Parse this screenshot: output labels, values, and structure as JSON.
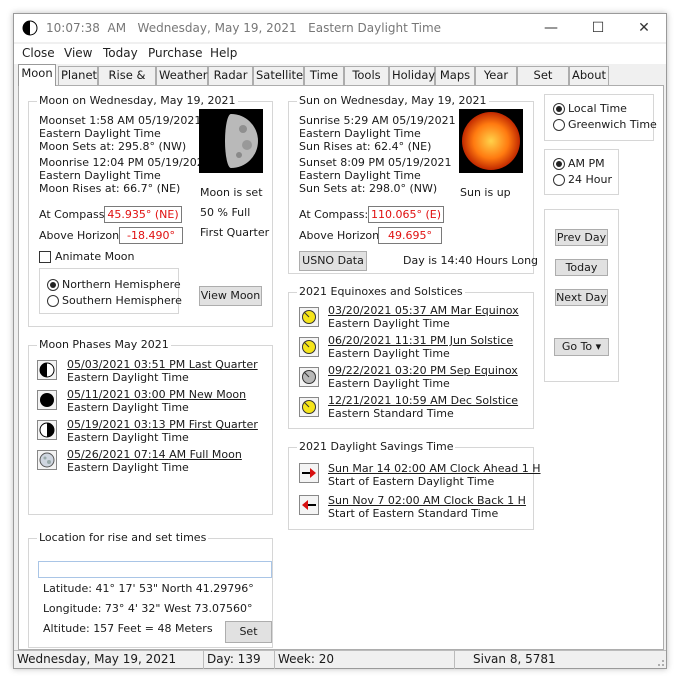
{
  "window": {
    "title": "10:07:38  AM   Wednesday, May 19, 2021   Eastern Daylight Time",
    "minimize": "—",
    "maximize": "☐",
    "close": "✕"
  },
  "menu": [
    "Close",
    "View",
    "Today",
    "Purchase",
    "Help"
  ],
  "tabs": [
    "Moon",
    "Planet",
    "Rise & Set",
    "Weather",
    "Radar",
    "Satellite",
    "Time",
    "Tools",
    "Holiday",
    "Maps",
    "Year",
    "Set",
    "About"
  ],
  "moon": {
    "header": "Moon on Wednesday, May 19, 2021",
    "moonset": "Moonset  1:58 AM  05/19/2021",
    "moonset_tz": "Eastern Daylight Time",
    "moon_sets_at": "Moon Sets at:  295.8° (NW)",
    "moonrise": "Moonrise 12:04 PM  05/19/2021",
    "moonrise_tz": "Eastern Daylight Time",
    "moon_rises_at": "Moon Rises at:  66.7° (NE)",
    "status": "Moon is set",
    "percent_full": "50 % Full",
    "phase_name": "First Quarter",
    "at_compass_label": "At Compass:",
    "at_compass_value": "45.935° (NE)",
    "above_horizon_label": "Above Horizon:",
    "above_horizon_value": "-18.490°",
    "animate_label": "Animate Moon",
    "hemisphere_north": "Northern Hemisphere",
    "hemisphere_south": "Southern Hemisphere",
    "view_moon_btn": "View Moon"
  },
  "sun": {
    "header": "Sun on Wednesday, May 19, 2021",
    "sunrise": "Sunrise 5:29 AM  05/19/2021",
    "sunrise_tz": "Eastern Daylight Time",
    "sun_rises_at": "Sun Rises at:  62.4° (NE)",
    "sunset": "Sunset  8:09 PM  05/19/2021",
    "sunset_tz": "Eastern Daylight Time",
    "sun_sets_at": "Sun Sets at:  298.0° (NW)",
    "status": "Sun is up",
    "at_compass_label": "At Compass:",
    "at_compass_value": "110.065° (E)",
    "above_horizon_label": "Above Horizon:",
    "above_horizon_value": "49.695°",
    "usno_btn": "USNO Data",
    "day_length": "Day is 14:40 Hours Long"
  },
  "options": {
    "local_time": "Local Time",
    "greenwich_time": "Greenwich Time",
    "am_pm": "AM PM",
    "h24": "24 Hour",
    "prev_day": "Prev Day",
    "today": "Today",
    "next_day": "Next Day",
    "go_to": "Go To ▾"
  },
  "phases": {
    "header": "Moon Phases  May 2021",
    "items": [
      {
        "line": "05/03/2021   03:51  PM   Last Quarter",
        "tz": "Eastern Daylight Time"
      },
      {
        "line": "05/11/2021   03:00  PM   New Moon",
        "tz": "Eastern Daylight Time"
      },
      {
        "line": "05/19/2021   03:13  PM   First Quarter",
        "tz": "Eastern Daylight Time"
      },
      {
        "line": "05/26/2021   07:14  AM   Full Moon",
        "tz": "Eastern Daylight Time"
      }
    ]
  },
  "equinox": {
    "header": "2021 Equinoxes and Solstices",
    "items": [
      {
        "line": "03/20/2021   05:37  AM  Mar Equinox",
        "tz": "Eastern Daylight Time"
      },
      {
        "line": "06/20/2021   11:31  PM  Jun Solstice",
        "tz": "Eastern Daylight Time"
      },
      {
        "line": "09/22/2021   03:20  PM  Sep Equinox",
        "tz": "Eastern Daylight Time"
      },
      {
        "line": "12/21/2021   10:59  AM  Dec Solstice",
        "tz": "Eastern Standard Time"
      }
    ]
  },
  "dst": {
    "header": "2021 Daylight Savings Time",
    "items": [
      {
        "line": "Sun Mar  14   02:00 AM Clock Ahead 1 H",
        "sub": "Start of Eastern Daylight Time"
      },
      {
        "line": "Sun Nov 7   02:00 AM Clock Back 1 H",
        "sub": "Start of Eastern Standard Time"
      }
    ]
  },
  "location": {
    "header": "Location for rise and set times",
    "input_value": "",
    "latitude": "Latitude:   41°  17'  53\"   North   41.29796°",
    "longitude": "Longitude:  73°  4'  32\"   West   73.07560°",
    "altitude": "Altitude:  157 Feet = 48 Meters",
    "set_btn": "Set"
  },
  "status": {
    "date": "Wednesday, May 19, 2021",
    "day": "Day: 139",
    "week": "Week: 20",
    "hebrew": "Sivan 8, 5781"
  }
}
